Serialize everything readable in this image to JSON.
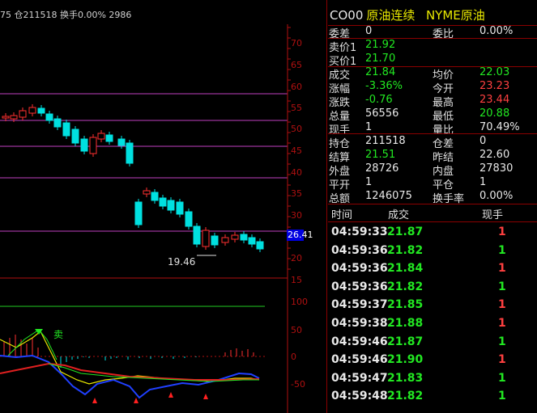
{
  "header": {
    "info_text": "75 仓211518 换手0.00% 2986"
  },
  "title": {
    "code": "CO00",
    "name1": "原油连续",
    "name2": "NYME原油"
  },
  "quote": [
    {
      "l1": "委差",
      "v1": "0",
      "c1": "white",
      "l2": "委比",
      "v2": "0.00%",
      "c2": "white"
    },
    {
      "l1": "卖价1",
      "v1": "21.92",
      "c1": "green",
      "l2": "",
      "v2": "",
      "c2": "white"
    },
    {
      "l1": "买价1",
      "v1": "21.70",
      "c1": "green",
      "l2": "",
      "v2": "",
      "c2": "white"
    },
    {
      "l1": "成交",
      "v1": "21.84",
      "c1": "green",
      "l2": "均价",
      "v2": "22.03",
      "c2": "green"
    },
    {
      "l1": "涨幅",
      "v1": "-3.36%",
      "c1": "green",
      "l2": "今开",
      "v2": "23.23",
      "c2": "red"
    },
    {
      "l1": "涨跌",
      "v1": "-0.76",
      "c1": "green",
      "l2": "最高",
      "v2": "23.44",
      "c2": "red"
    },
    {
      "l1": "总量",
      "v1": "56556",
      "c1": "white",
      "l2": "最低",
      "v2": "20.88",
      "c2": "green"
    },
    {
      "l1": "现手",
      "v1": "1",
      "c1": "white",
      "l2": "量比",
      "v2": "70.49%",
      "c2": "white"
    },
    {
      "l1": "持仓",
      "v1": "211518",
      "c1": "white",
      "l2": "仓差",
      "v2": "0",
      "c2": "white"
    },
    {
      "l1": "结算",
      "v1": "21.51",
      "c1": "green",
      "l2": "昨结",
      "v2": "22.60",
      "c2": "white"
    },
    {
      "l1": "外盘",
      "v1": "28726",
      "c1": "white",
      "l2": "内盘",
      "v2": "27830",
      "c2": "white"
    },
    {
      "l1": "平开",
      "v1": "1",
      "c1": "white",
      "l2": "平仓",
      "v2": "1",
      "c2": "white"
    },
    {
      "l1": "总额",
      "v1": "1246075",
      "c1": "white",
      "l2": "换手率",
      "v2": "0.00%",
      "c2": "white"
    }
  ],
  "trades_header": {
    "time": "时间",
    "price": "成交",
    "vol": "现手"
  },
  "trades": [
    {
      "time": "04:59:33",
      "price": "21.87",
      "vol": "1",
      "vc": "red"
    },
    {
      "time": "04:59:36",
      "price": "21.82",
      "vol": "1",
      "vc": "green"
    },
    {
      "time": "04:59:36",
      "price": "21.84",
      "vol": "1",
      "vc": "red"
    },
    {
      "time": "04:59:36",
      "price": "21.82",
      "vol": "1",
      "vc": "green"
    },
    {
      "time": "04:59:37",
      "price": "21.85",
      "vol": "1",
      "vc": "red"
    },
    {
      "time": "04:59:38",
      "price": "21.88",
      "vol": "1",
      "vc": "red"
    },
    {
      "time": "04:59:46",
      "price": "21.87",
      "vol": "1",
      "vc": "green"
    },
    {
      "time": "04:59:46",
      "price": "21.90",
      "vol": "1",
      "vc": "red"
    },
    {
      "time": "04:59:47",
      "price": "21.83",
      "vol": "1",
      "vc": "green"
    },
    {
      "time": "04:59:48",
      "price": "21.82",
      "vol": "1",
      "vc": "green"
    }
  ],
  "chart": {
    "price_axis": [
      "70",
      "65",
      "60",
      "55",
      "50",
      "45",
      "40",
      "35",
      "30",
      "25",
      "20",
      "15"
    ],
    "indicator_axis": [
      "100",
      "50",
      "0",
      "-50"
    ],
    "last_price_tag": "26.41",
    "low_annotation": "19.46",
    "signal_text": "卖",
    "colors": {
      "up": "#ff3030",
      "down": "#00e0e0",
      "axis": "#b01010",
      "purple": "#c040c0"
    }
  }
}
